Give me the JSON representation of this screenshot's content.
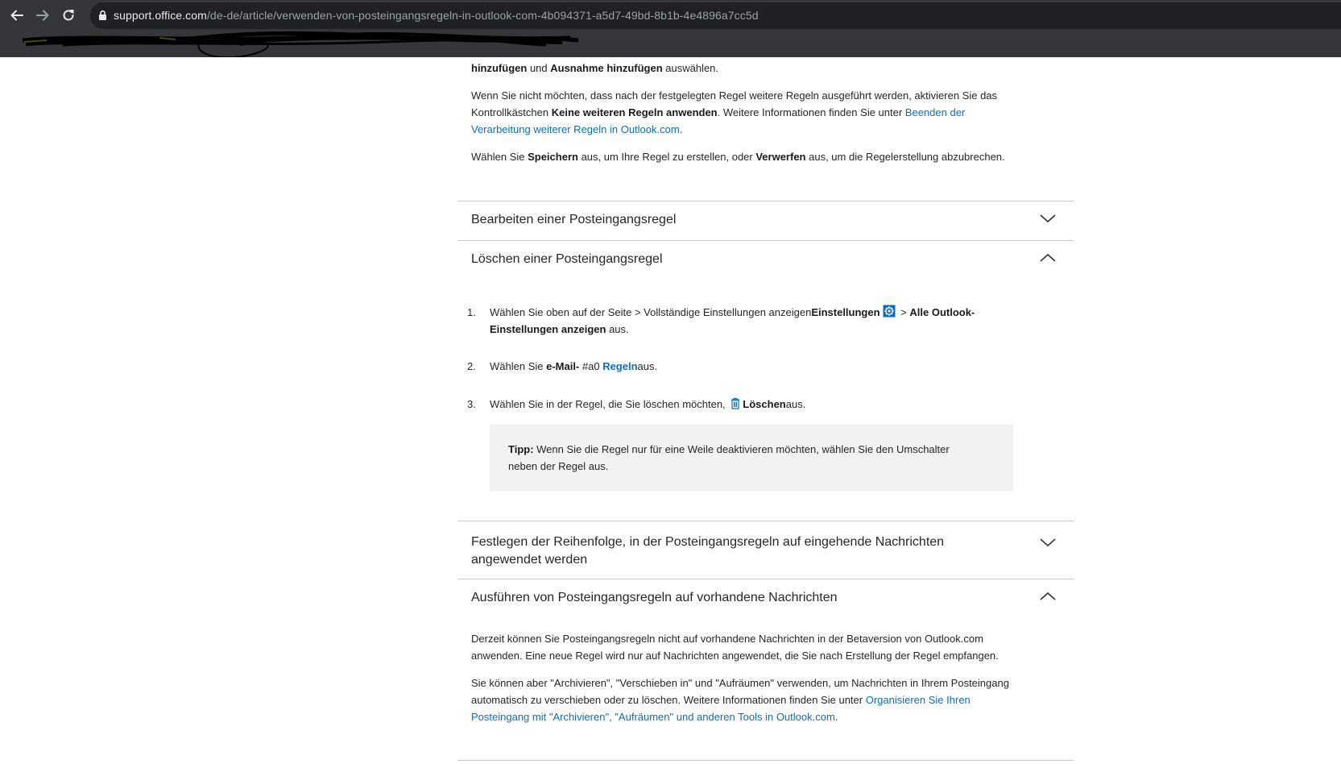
{
  "browser": {
    "url_host": "support.office.com",
    "url_path": "/de-de/article/verwenden-von-posteingangsregeln-in-outlook-com-4b094371-a5d7-49bd-8b1b-4e4896a7cc5d",
    "accent": "#0f6cbd"
  },
  "intro": {
    "p0_b1": "hinzufügen",
    "p0_t1": " und ",
    "p0_b2": "Ausnahme hinzufügen",
    "p0_t2": " auswählen.",
    "p1_t1": "Wenn Sie nicht möchten, dass nach der festgelegten Regel weitere Regeln ausgeführt werden, aktivieren Sie das Kontrollkästchen ",
    "p1_b1": "Keine weiteren Regeln anwenden",
    "p1_t2": ". Weitere Informationen finden Sie unter ",
    "p1_link": "Beenden der Verarbeitung weiterer Regeln in Outlook.com",
    "p1_t3": ".",
    "p2_t1": "Wählen Sie ",
    "p2_b1": "Speichern",
    "p2_t2": " aus, um Ihre Regel zu erstellen, oder ",
    "p2_b2": "Verwerfen",
    "p2_t3": " aus, um die Regelerstellung abzubrechen."
  },
  "accordion": {
    "edit_title": "Bearbeiten einer Posteingangsregel",
    "delete_title": "Löschen einer Posteingangsregel",
    "order_title": "Festlegen der Reihenfolge, in der Posteingangsregeln auf eingehende Nachrichten angewendet werden",
    "existing_title": "Ausführen von Posteingangsregeln auf vorhandene Nachrichten"
  },
  "steps": {
    "s1_num": "1.",
    "s1_t1": "Wählen Sie oben auf der Seite > Vollständige Einstellungen anzeigen",
    "s1_b1": "Einstellungen",
    "s1_t2": " > ",
    "s1_b2": "Alle Outlook-Einstellungen anzeigen",
    "s1_t3": " aus.",
    "s2_num": "2.",
    "s2_t1": "Wählen Sie ",
    "s2_b1": "e-Mail-",
    "s2_t2": " #a0 ",
    "s2_link": "Regeln",
    "s2_t3": "aus.",
    "s3_num": "3.",
    "s3_t1": "Wählen Sie in der Regel, die Sie löschen möchten, ",
    "s3_b1": "Löschen",
    "s3_t2": "aus."
  },
  "tip": {
    "label": "Tipp:",
    "text": " Wenn Sie die Regel nur für eine Weile deaktivieren möchten, wählen Sie den Umschalter neben der Regel aus."
  },
  "existing": {
    "p1": "Derzeit können Sie Posteingangsregeln nicht auf vorhandene Nachrichten in der Betaversion von Outlook.com anwenden. Eine neue Regel wird nur auf Nachrichten angewendet, die Sie nach Erstellung der Regel empfangen.",
    "p2_t1": "Sie können aber \"Archivieren\", \"Verschieben in\" und \"Aufräumen\" verwenden, um Nachrichten in Ihrem Posteingang automatisch zu verschieben oder zu löschen. Weitere Informationen finden Sie unter ",
    "p2_link": "Organisieren Sie Ihren Posteingang mit \"Archivieren\", \"Aufräumen\" und anderen Tools in Outlook.com",
    "p2_t2": "."
  }
}
